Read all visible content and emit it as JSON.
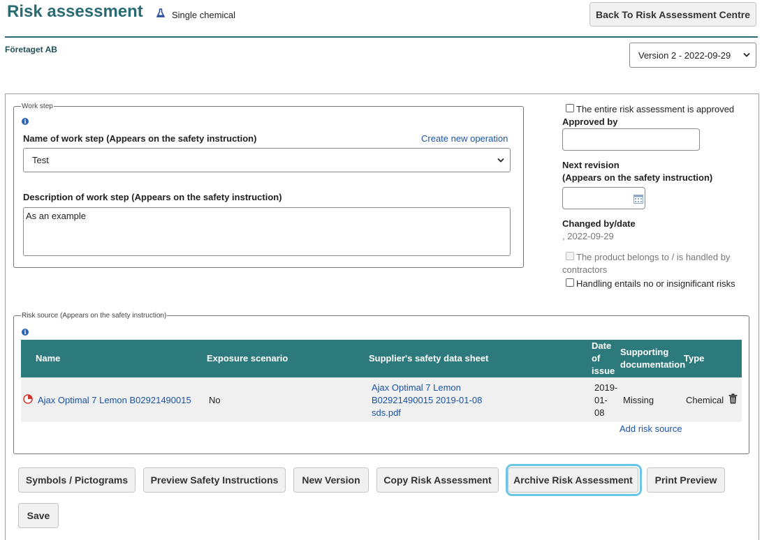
{
  "header": {
    "title": "Risk assessment",
    "subtype": "Single chemical",
    "back_button": "Back To Risk Assessment Centre",
    "company": "Företaget AB",
    "version": "Version 2 - 2022-09-29"
  },
  "work_step": {
    "legend": "Work step",
    "name_label": "Name of work step (Appears on the safety instruction)",
    "create_link": "Create new operation",
    "name_value": "Test",
    "desc_label": "Description of work step (Appears on the safety instruction)",
    "desc_value": "As an example"
  },
  "side": {
    "approved_check": "The entire risk assessment is approved",
    "approved_by_label": "Approved by",
    "approved_by_value": "",
    "next_revision_label": "Next revision",
    "next_revision_sub": "(Appears on the safety instruction)",
    "next_revision_value": "",
    "changed_label": "Changed by/date",
    "changed_value": ", 2022-09-29",
    "contractors_line1": "The product belongs to / is handled by",
    "contractors_line2": "contractors",
    "insignificant_check": "Handling entails no or insignificant risks"
  },
  "risk_source": {
    "legend": "Risk source (Appears on the safety instruction)",
    "columns": {
      "name": "Name",
      "exposure": "Exposure scenario",
      "sds": "Supplier's safety data sheet",
      "date_1": "Date",
      "date_2": "of",
      "date_3": "issue",
      "support_1": "Supporting",
      "support_2": "documentation",
      "type": "Type"
    },
    "rows": [
      {
        "name": "Ajax Optimal 7 Lemon B02921490015",
        "exposure": "No",
        "sds_1": "Ajax Optimal 7 Lemon",
        "sds_2": "B02921490015 2019-01-08",
        "sds_3": "sds.pdf",
        "date_1": "2019-",
        "date_2": "01-",
        "date_3": "08",
        "support": "Missing",
        "type": "Chemical"
      }
    ],
    "add_link": "Add risk source"
  },
  "actions": {
    "symbols": "Symbols / Pictograms",
    "preview": "Preview Safety Instructions",
    "new_version": "New Version",
    "copy": "Copy Risk Assessment",
    "archive": "Archive Risk Assessment",
    "print": "Print Preview",
    "save": "Save"
  },
  "colors": {
    "title": "#2a6a72",
    "table_header": "#2d7a7c",
    "link": "#1a53a8",
    "focus_ring": "#6cc4e6",
    "status_icon": "#d0352f"
  },
  "icons": {
    "subtype": "flask-icon",
    "info": "info-icon",
    "status": "pie-status-icon",
    "delete": "trash-icon",
    "calendar": "calendar-icon",
    "dropdown": "chevron-down-icon"
  }
}
